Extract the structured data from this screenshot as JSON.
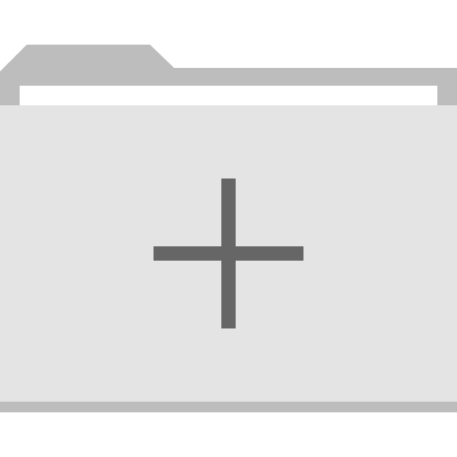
{
  "icon": {
    "name": "new-folder-icon",
    "parts": {
      "tab": "folder-tab",
      "back": "folder-back",
      "paper": "folder-paper",
      "front": "folder-front",
      "bottom_edge": "folder-bottom-edge",
      "plus": "plus-icon"
    }
  },
  "colors": {
    "folder_back": "#BDBDBD",
    "folder_front": "#E4E4E4",
    "paper": "#FFFFFF",
    "bottom_edge": "#BDBDBD",
    "plus": "#666666",
    "background": "#FFFFFF"
  }
}
